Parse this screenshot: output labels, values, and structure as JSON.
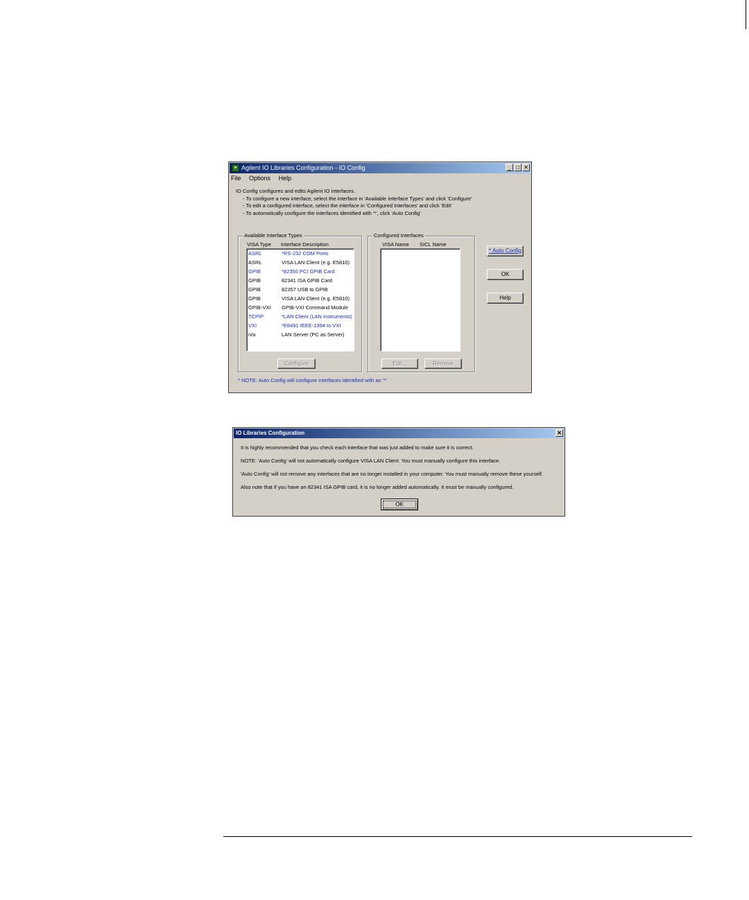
{
  "main_window": {
    "title": "Agilent IO Libraries Configuration - IO Config",
    "window_buttons": [
      "_",
      "□",
      "✕"
    ],
    "menu": [
      {
        "label": "File"
      },
      {
        "label": "Options"
      },
      {
        "label": "Help"
      }
    ],
    "intro": {
      "line": "IO Config configures and edits Agilent IO interfaces.",
      "bullets": [
        "- To configure a new interface, select the interface in 'Available Interface Types' and click 'Configure'",
        "- To edit a configured interface, select the interface in 'Configured Interfaces' and click 'Edit'",
        "- To automatically configure the interfaces identified with '*', click 'Auto Config'"
      ]
    },
    "available": {
      "label": "Available Interface Types",
      "col_visa_type": "VISA Type",
      "col_description": "Interface Description",
      "rows": [
        {
          "type": "ASRL",
          "desc": "*RS-232 COM Ports",
          "auto": true
        },
        {
          "type": "ASRL",
          "desc": "VISA LAN Client (e.g. E5810)",
          "auto": false
        },
        {
          "type": "GPIB",
          "desc": "*82350 PCI GPIB Card",
          "auto": true
        },
        {
          "type": "GPIB",
          "desc": "82341 ISA GPIB Card",
          "auto": false
        },
        {
          "type": "GPIB",
          "desc": "82357 USB to GPIB",
          "auto": false
        },
        {
          "type": "GPIB",
          "desc": "VISA LAN Client (e.g. E5810)",
          "auto": false
        },
        {
          "type": "GPIB-VXI",
          "desc": "GPIB-VXI Command Module",
          "auto": false
        },
        {
          "type": "TCPIP",
          "desc": "*LAN Client (LAN Instruments)",
          "auto": true
        },
        {
          "type": "VXI",
          "desc": "*E8491 IEEE-1394 to VXI",
          "auto": true
        },
        {
          "type": "n/a",
          "desc": "LAN Server (PC as Server)",
          "auto": false
        }
      ],
      "configure_label": "Configure"
    },
    "configured": {
      "label": "Configured Interfaces",
      "col_visa_name": "VISA Name",
      "col_sicl_name": "SICL Name",
      "edit_label": "Edit...",
      "remove_label": "Remove"
    },
    "auto_config_label": "* Auto Config",
    "ok_label": "OK",
    "help_label": "Help",
    "note": "* NOTE: Auto Config will configure interfaces identified with an '*'",
    "colors": {
      "auto_item": "#1a2ab8",
      "normal_item": "#000000",
      "title_start": "#0a246a",
      "title_end": "#a6caf0"
    }
  },
  "dialog": {
    "title": "IO Libraries Configuration",
    "close": "✕",
    "messages": [
      "It is highly recommended that you check each interface that was just added to make sure it is correct.",
      "NOTE: 'Auto Config' will not automatically configure VISA LAN Client.  You must manually configure this interface.",
      "'Auto Config' will not remove any interfaces that are no longer installed in your computer.  You must manually remove these yourself.",
      "Also note that if you have an 82341 ISA GPIB card, it is no longer added automatically.  It must be manually configured."
    ],
    "ok_label": "OK"
  }
}
